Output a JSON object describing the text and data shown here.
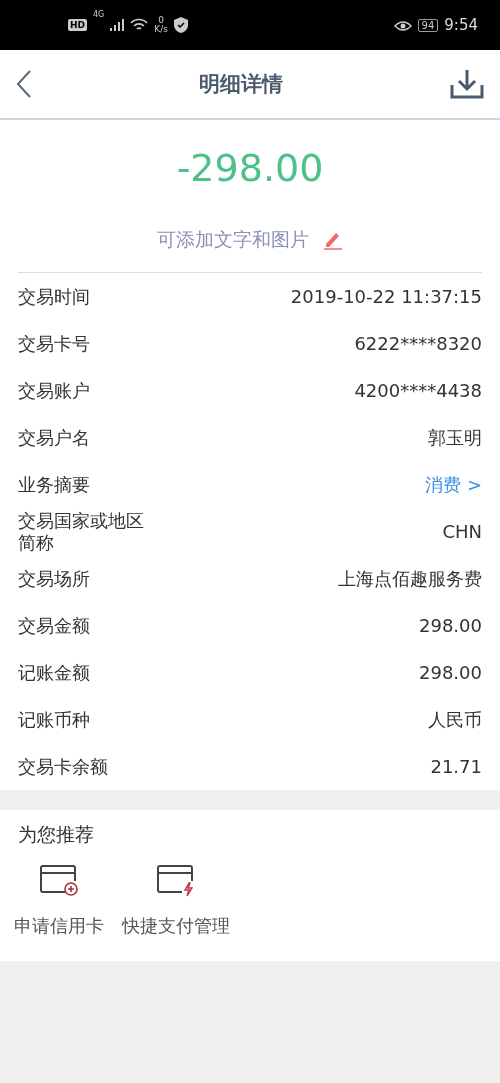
{
  "status_bar": {
    "hd": "HD",
    "network": "4G",
    "speed_value": "0",
    "speed_unit": "K/s",
    "battery": "94",
    "time": "9:54"
  },
  "header": {
    "title": "明细详情"
  },
  "amount": "-298.00",
  "note": "可添加文字和图片",
  "details": [
    {
      "kind": "value",
      "label": "交易时间",
      "value": "2019-10-22 11:37:15"
    },
    {
      "kind": "value",
      "label": "交易卡号",
      "value": "6222****8320"
    },
    {
      "kind": "value",
      "label": "交易账户",
      "value": "4200****4438"
    },
    {
      "kind": "value",
      "label": "交易户名",
      "value": "郭玉明"
    },
    {
      "kind": "link",
      "label": "业务摘要",
      "value": "消费 >"
    },
    {
      "kind": "value",
      "label": "交易国家或地区简称",
      "value": "CHN"
    },
    {
      "kind": "value",
      "label": "交易场所",
      "value": "上海点佰趣服务费"
    },
    {
      "kind": "value",
      "label": "交易金额",
      "value": "298.00"
    },
    {
      "kind": "value",
      "label": "记账金额",
      "value": "298.00"
    },
    {
      "kind": "value",
      "label": "记账币种",
      "value": "人民币"
    },
    {
      "kind": "value",
      "label": "交易卡余额",
      "value": "21.71"
    }
  ],
  "recommend": {
    "title": "为您推荐",
    "items": [
      {
        "kind": "apply",
        "label": "申请信用卡"
      },
      {
        "kind": "quickpay",
        "label": "快捷支付管理"
      }
    ]
  }
}
